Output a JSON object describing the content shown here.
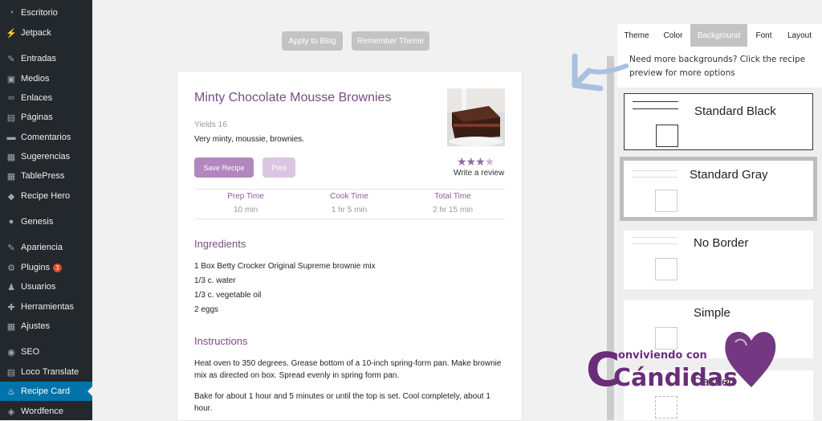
{
  "sidebar": {
    "items": [
      {
        "label": "Escritorio",
        "icon": "dashboard-icon",
        "glyph": "◔"
      },
      {
        "label": "Jetpack",
        "icon": "jetpack-icon",
        "glyph": "⚡"
      },
      {
        "label": "Entradas",
        "icon": "pin-icon",
        "glyph": "✎"
      },
      {
        "label": "Medios",
        "icon": "media-icon",
        "glyph": "▣"
      },
      {
        "label": "Enlaces",
        "icon": "link-icon",
        "glyph": "∞"
      },
      {
        "label": "Páginas",
        "icon": "page-icon",
        "glyph": "▤"
      },
      {
        "label": "Comentarios",
        "icon": "comment-icon",
        "glyph": "▬"
      },
      {
        "label": "Sugerencias",
        "icon": "suggestion-icon",
        "glyph": "▦"
      },
      {
        "label": "TablePress",
        "icon": "table-icon",
        "glyph": "▦"
      },
      {
        "label": "Recipe Hero",
        "icon": "recipe-hero-icon",
        "glyph": "◆"
      },
      {
        "label": "Genesis",
        "icon": "genesis-icon",
        "glyph": "●"
      },
      {
        "label": "Apariencia",
        "icon": "appearance-icon",
        "glyph": "✎"
      },
      {
        "label": "Plugins",
        "icon": "plugin-icon",
        "glyph": "⚙",
        "badge": "3"
      },
      {
        "label": "Usuarios",
        "icon": "users-icon",
        "glyph": "♟"
      },
      {
        "label": "Herramientas",
        "icon": "tools-icon",
        "glyph": "✚"
      },
      {
        "label": "Ajustes",
        "icon": "settings-icon",
        "glyph": "▦"
      },
      {
        "label": "SEO",
        "icon": "seo-icon",
        "glyph": "◉"
      },
      {
        "label": "Loco Translate",
        "icon": "translate-icon",
        "glyph": "▤"
      },
      {
        "label": "Recipe Card",
        "icon": "recipe-card-icon",
        "glyph": "♨",
        "active": true
      },
      {
        "label": "Wordfence",
        "icon": "wordfence-icon",
        "glyph": "◈"
      }
    ]
  },
  "toolbar": {
    "apply_label": "Apply to Blog",
    "remember_label": "Remember Theme"
  },
  "recipe": {
    "title": "Minty Chocolate Mousse Brownies",
    "yields": "Yields 16",
    "description": "Very minty, moussie, brownies.",
    "save_label": "Save Recipe",
    "print_label": "Print",
    "rating_stars": 3.5,
    "write_review": "Write a review",
    "times": {
      "prep_label": "Prep Time",
      "prep_value": "10 min",
      "cook_label": "Cook Time",
      "cook_value": "1 hr 5 min",
      "total_label": "Total Time",
      "total_value": "2 hr 15 min"
    },
    "ingredients_heading": "Ingredients",
    "ingredients": [
      "1 Box Betty Crocker Original Supreme brownie mix",
      "1/3 c. water",
      "1/3 c. vegetable oil",
      "2 eggs"
    ],
    "instructions_heading": "Instructions",
    "instructions": [
      "Heat oven to 350 degrees. Grease bottom of a 10-inch spring-form pan. Make brownie mix as directed on box. Spread evenly in spring form pan.",
      "Bake for about 1 hour and 5 minutes or until the top is set. Cool completely, about 1 hour."
    ]
  },
  "panel": {
    "tabs": [
      "Theme",
      "Color",
      "Background",
      "Font",
      "Layout"
    ],
    "active_tab": "Background",
    "hint": "Need more backgrounds? Click the recipe preview for more options",
    "options": [
      "Standard Black",
      "Standard Gray",
      "No Border",
      "Simple",
      "Dashed"
    ]
  },
  "watermark": {
    "line1": "onviviendo con",
    "line2": "Cándidas"
  },
  "colors": {
    "accent_purple": "#7b4a86",
    "wp_sidebar": "#23282d",
    "wp_active": "#0073aa"
  }
}
